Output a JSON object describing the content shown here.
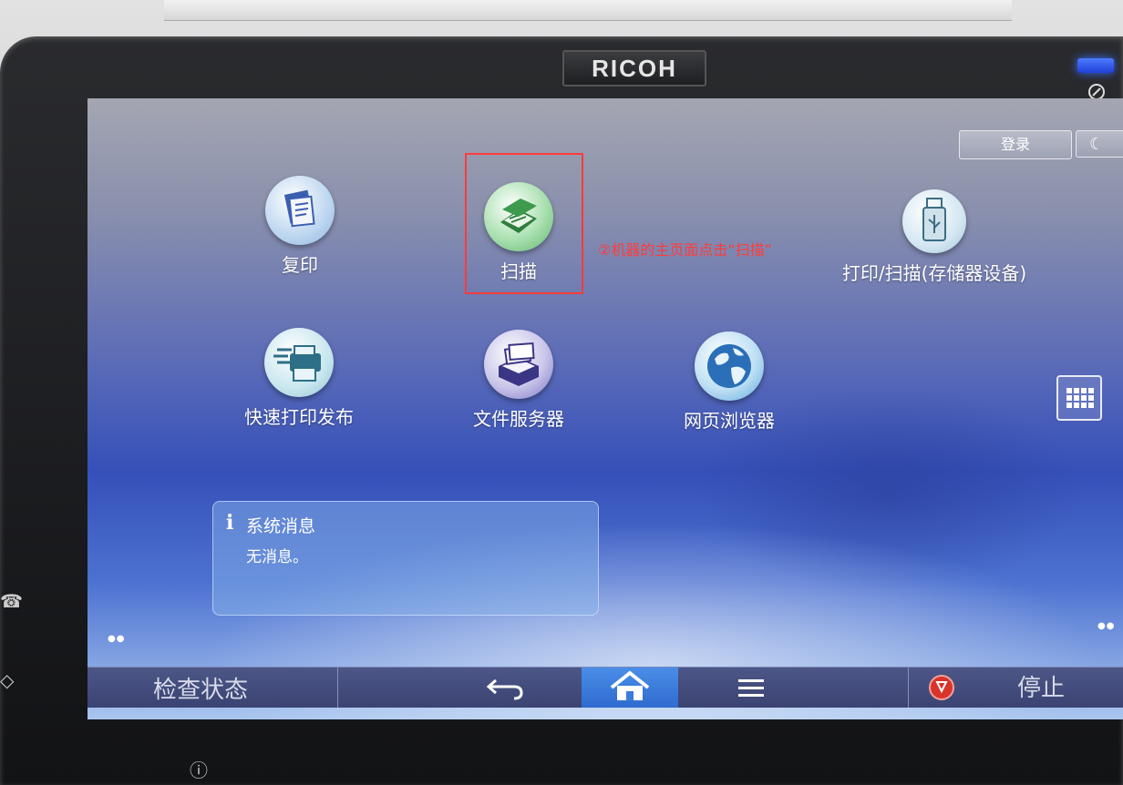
{
  "device": {
    "brand": "RICOH"
  },
  "header": {
    "login_label": "登录",
    "sleep_symbol": "☾"
  },
  "apps": [
    {
      "label": "复印",
      "icon": "copy-icon"
    },
    {
      "label": "扫描",
      "icon": "scanner-icon"
    },
    {
      "label": "打印/扫描(存储器设备)",
      "icon": "usb-icon"
    },
    {
      "label": "快速打印发布",
      "icon": "quick-print-icon"
    },
    {
      "label": "文件服务器",
      "icon": "document-server-icon"
    },
    {
      "label": "网页浏览器",
      "icon": "globe-icon"
    }
  ],
  "annotation": {
    "text": "②机器的主页面点击“扫描”"
  },
  "system_message": {
    "title": "系统消息",
    "body": "无消息。"
  },
  "bottom_bar": {
    "status_check_label": "检查状态",
    "stop_label": "停止"
  },
  "colors": {
    "annotation": "#ff3b3b",
    "home_active": "#3a7be0",
    "stop": "#d9342b"
  }
}
